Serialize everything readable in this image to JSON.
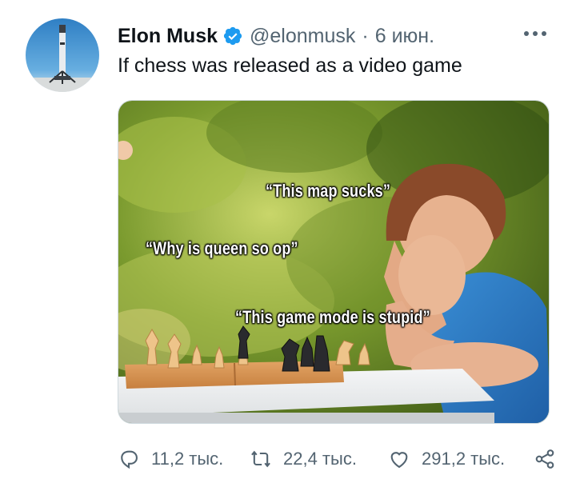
{
  "author": {
    "name": "Elon Musk",
    "handle": "@elonmusk",
    "separator": "·",
    "date": "6 июн.",
    "verified": true
  },
  "tweet": {
    "text": "If chess was released as a video game"
  },
  "media": {
    "captions": {
      "top": "“This map sucks”",
      "middle": "“Why is queen so op”",
      "bottom": "“This game mode is stupid”"
    }
  },
  "actions": {
    "replies": "11,2 тыс.",
    "retweets": "22,4 тыс.",
    "likes": "291,2 тыс."
  },
  "icons": {
    "more": "more-horizontal-icon",
    "reply": "reply-icon",
    "retweet": "retweet-icon",
    "like": "heart-icon",
    "share": "share-icon",
    "verified": "verified-badge-icon"
  },
  "colors": {
    "text": "#0f1419",
    "secondary": "#536471",
    "verified": "#1d9bf0"
  }
}
